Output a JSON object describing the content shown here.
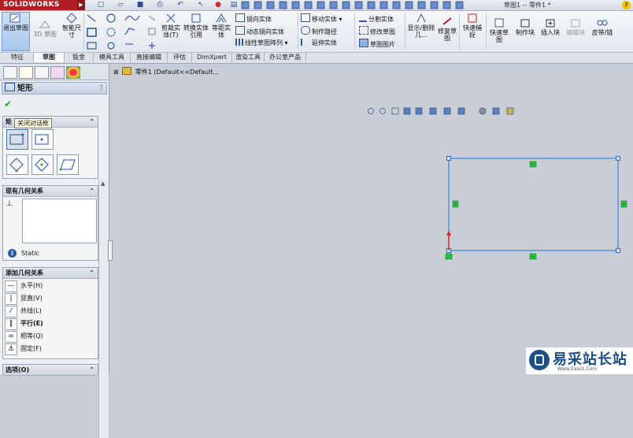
{
  "titlebar": {
    "logo": "SOLIDWORKS",
    "doc_title": "草图1 -- 零件1 *"
  },
  "ribbon": {
    "exit_sketch": "退出草图",
    "sketch3d": "3D 草图",
    "smart_dim": "智能尺寸",
    "trim": "剪裁实体(T)",
    "convert": "转换实体引用",
    "offset": "等距实体",
    "mirror": "镜向实体",
    "dyn_mirror": "动态镜向实体",
    "linear_pattern": "线性草图阵列",
    "move": "移动实体",
    "construction": "制作路径",
    "extend": "延伸实体",
    "split": "分割实体",
    "modify": "修改草图",
    "sketch_pic": "草图图片",
    "display_relations": "显示/删除几...",
    "repair": "修复草图",
    "quick_snap": "快速捕捉",
    "rapid_sketch": "快速草图",
    "make_block": "制作块",
    "insert_block": "插入块",
    "edit_block": "编辑块",
    "belt": "皮带/链"
  },
  "tabs": [
    "特征",
    "草图",
    "钣金",
    "模具工具",
    "直接编辑",
    "评估",
    "DimXpert",
    "渲染工具",
    "办公室产品"
  ],
  "active_tab": "草图",
  "panel": {
    "title": "矩形",
    "tooltip": "关闭对话框",
    "group1_title": "矩",
    "existing_title": "现有几何关系",
    "status": "Static",
    "add_title": "添加几何关系",
    "relations": [
      "水平(H)",
      "竖直(V)",
      "共线(L)",
      "平行(E)",
      "相等(Q)",
      "固定(F)"
    ],
    "options_title": "选项(O)"
  },
  "tree": {
    "item": "零件1 (Default<<Default..."
  },
  "watermark": {
    "text": "易采站长站",
    "sub": "Www.Easck.Com"
  },
  "colors": {
    "sketch_line": "#3a86d9",
    "handle_green": "#22c33a",
    "origin_red": "#d42020",
    "logo_red": "#b11f24"
  }
}
